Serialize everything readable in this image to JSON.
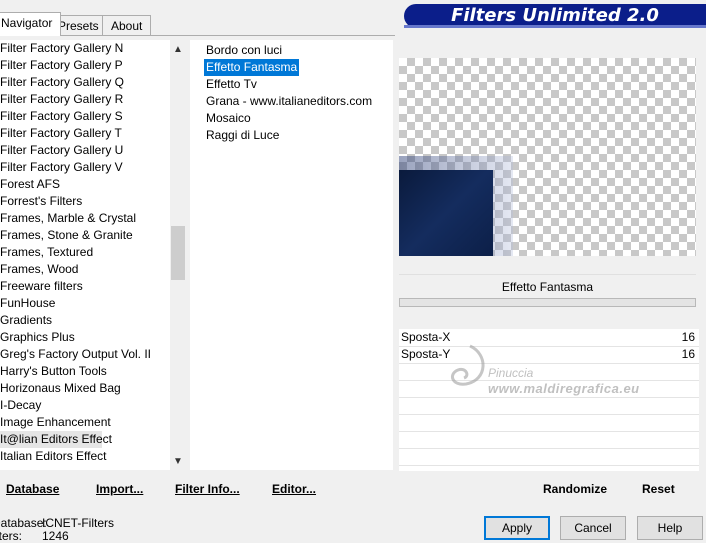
{
  "tabs": [
    "Navigator",
    "Presets",
    "About"
  ],
  "title": "Filters Unlimited 2.0",
  "categories": [
    "Filter Factory Gallery N",
    "Filter Factory Gallery P",
    "Filter Factory Gallery Q",
    "Filter Factory Gallery R",
    "Filter Factory Gallery S",
    "Filter Factory Gallery T",
    "Filter Factory Gallery U",
    "Filter Factory Gallery V",
    "Forest AFS",
    "Forrest's Filters",
    "Frames, Marble & Crystal",
    "Frames, Stone & Granite",
    "Frames, Textured",
    "Frames, Wood",
    "Freeware filters",
    "FunHouse",
    "Gradients",
    "Graphics Plus",
    "Greg's Factory Output Vol. II",
    "Harry's Button Tools",
    "Horizonaus Mixed Bag",
    "I-Decay",
    "Image Enhancement",
    "It@lian Editors Effect",
    "Italian Editors Effect"
  ],
  "selected_category": "It@lian Editors Effect",
  "filters": [
    "Bordo con luci",
    "Effetto Fantasma",
    "Effetto Tv",
    "Grana - www.italianeditors.com",
    "Mosaico",
    "Raggi di Luce"
  ],
  "selected_filter": "Effetto Fantasma",
  "filter_name": "Effetto Fantasma",
  "params": [
    {
      "label": "Sposta-X",
      "value": "16"
    },
    {
      "label": "Sposta-Y",
      "value": "16"
    }
  ],
  "watermark": {
    "line1": "Pinuccia",
    "line2": "www.maldiregrafica.eu"
  },
  "buttons": {
    "database": "Database",
    "import": "Import...",
    "filter_info": "Filter Info...",
    "editor": "Editor...",
    "randomize": "Randomize",
    "reset": "Reset",
    "apply": "Apply",
    "cancel": "Cancel",
    "help": "Help"
  },
  "info": {
    "database_label": "Database:",
    "database_value": "ICNET-Filters",
    "filters_label": "Filters:",
    "filters_value": "1246"
  }
}
